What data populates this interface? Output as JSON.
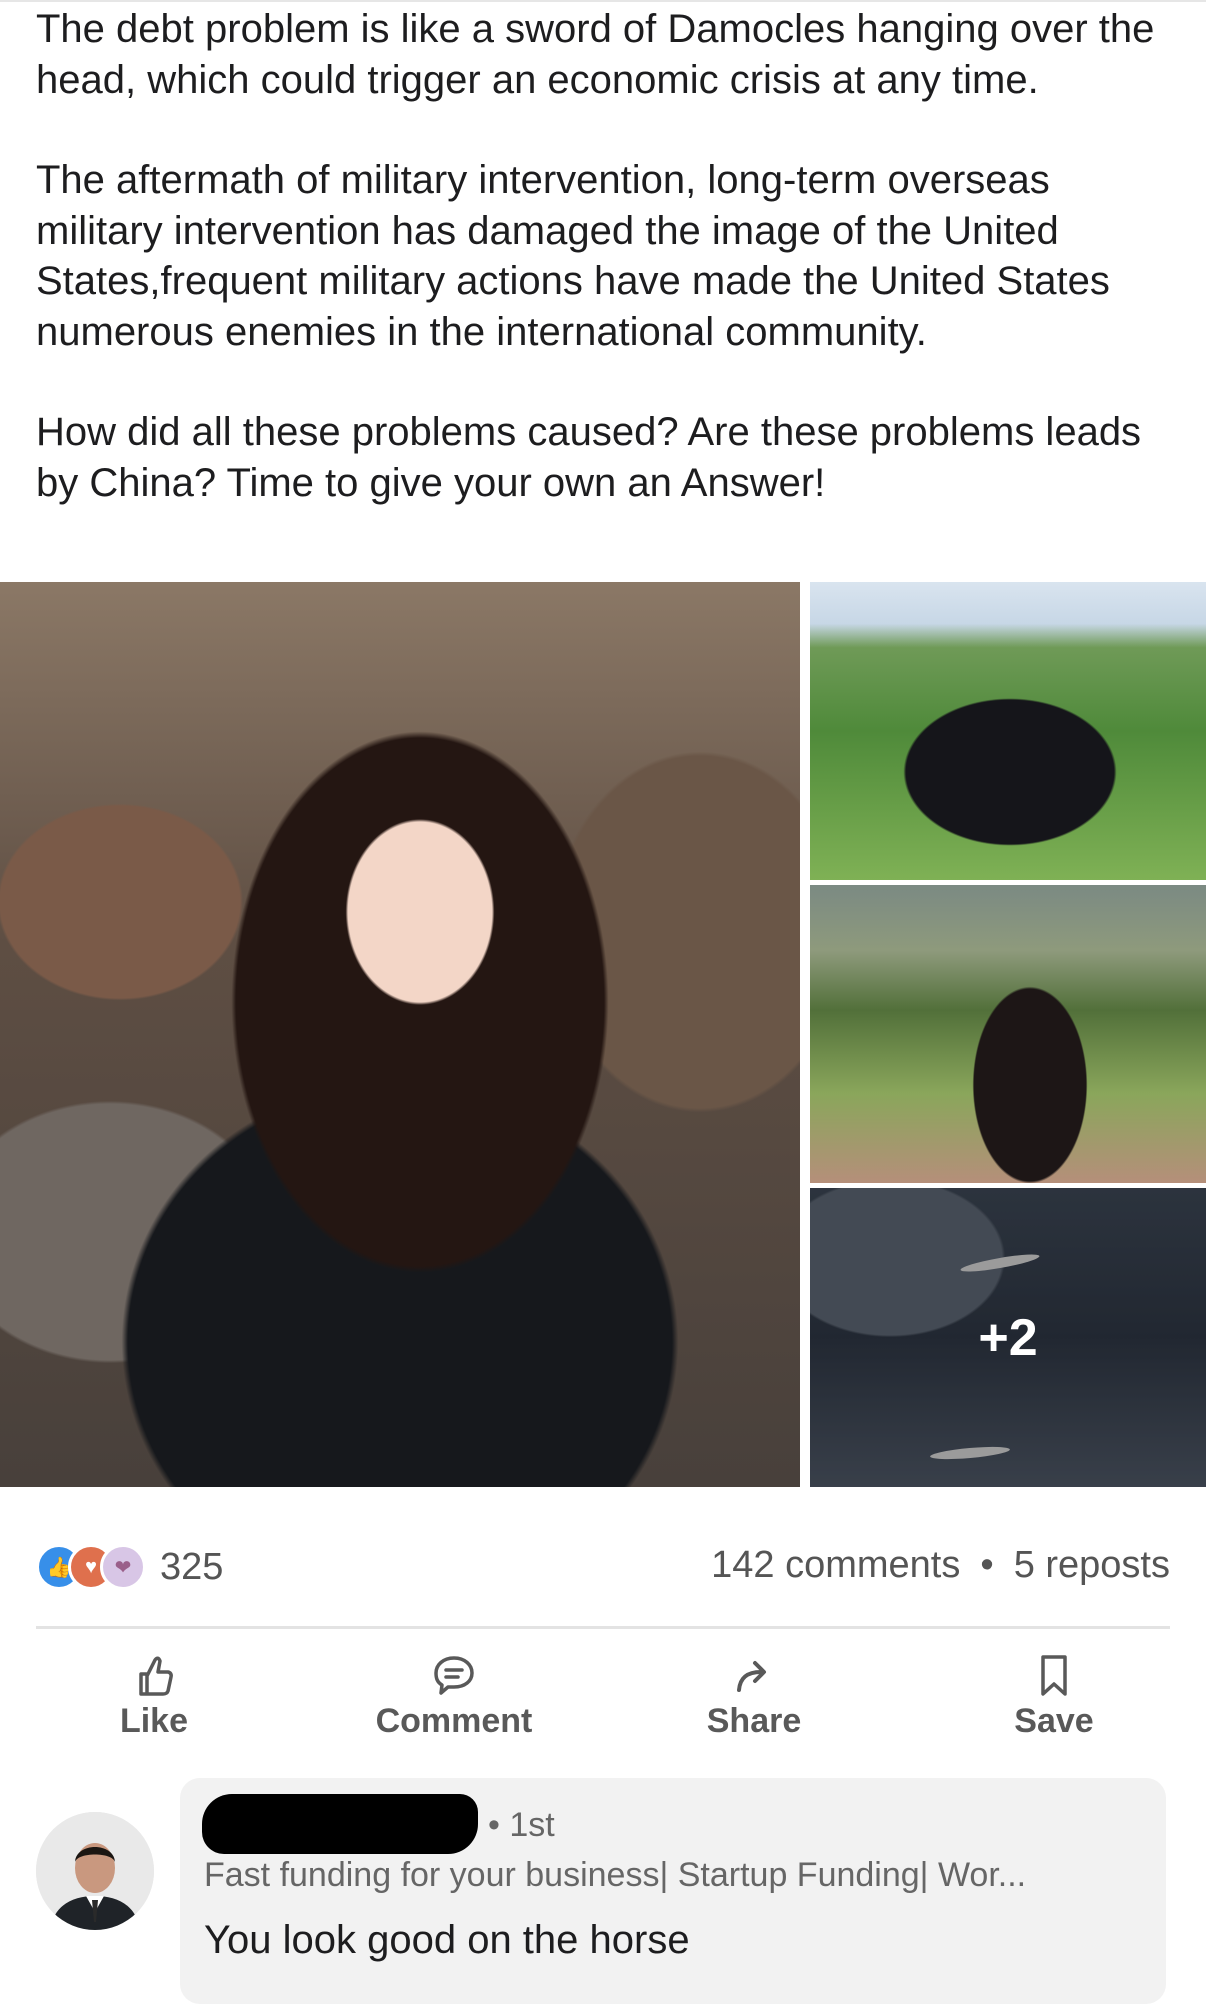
{
  "post": {
    "paragraphs": [
      "The debt problem is like a sword of Damocles hanging over the head, which could trigger an economic crisis at any time.",
      "The aftermath of military intervention, long-term overseas military intervention has damaged the image of the United States,frequent military actions have made the United States numerous enemies in the international community.",
      "How did all these problems caused? Are these problems leads by China? Time to give your own an Answer!"
    ]
  },
  "gallery": {
    "more_count": "+2"
  },
  "stats": {
    "reaction_count": "325",
    "comments": "142 comments",
    "separator": "•",
    "reposts": "5 reposts"
  },
  "actions": {
    "like": "Like",
    "comment": "Comment",
    "share": "Share",
    "save": "Save"
  },
  "comment": {
    "degree": "• 1st",
    "headline": "Fast funding for your business| Startup Funding| Wor...",
    "text": "You look good on the horse"
  },
  "colors": {
    "like": "#378fe9",
    "love": "#df704d",
    "support": "#d8c6e6"
  }
}
